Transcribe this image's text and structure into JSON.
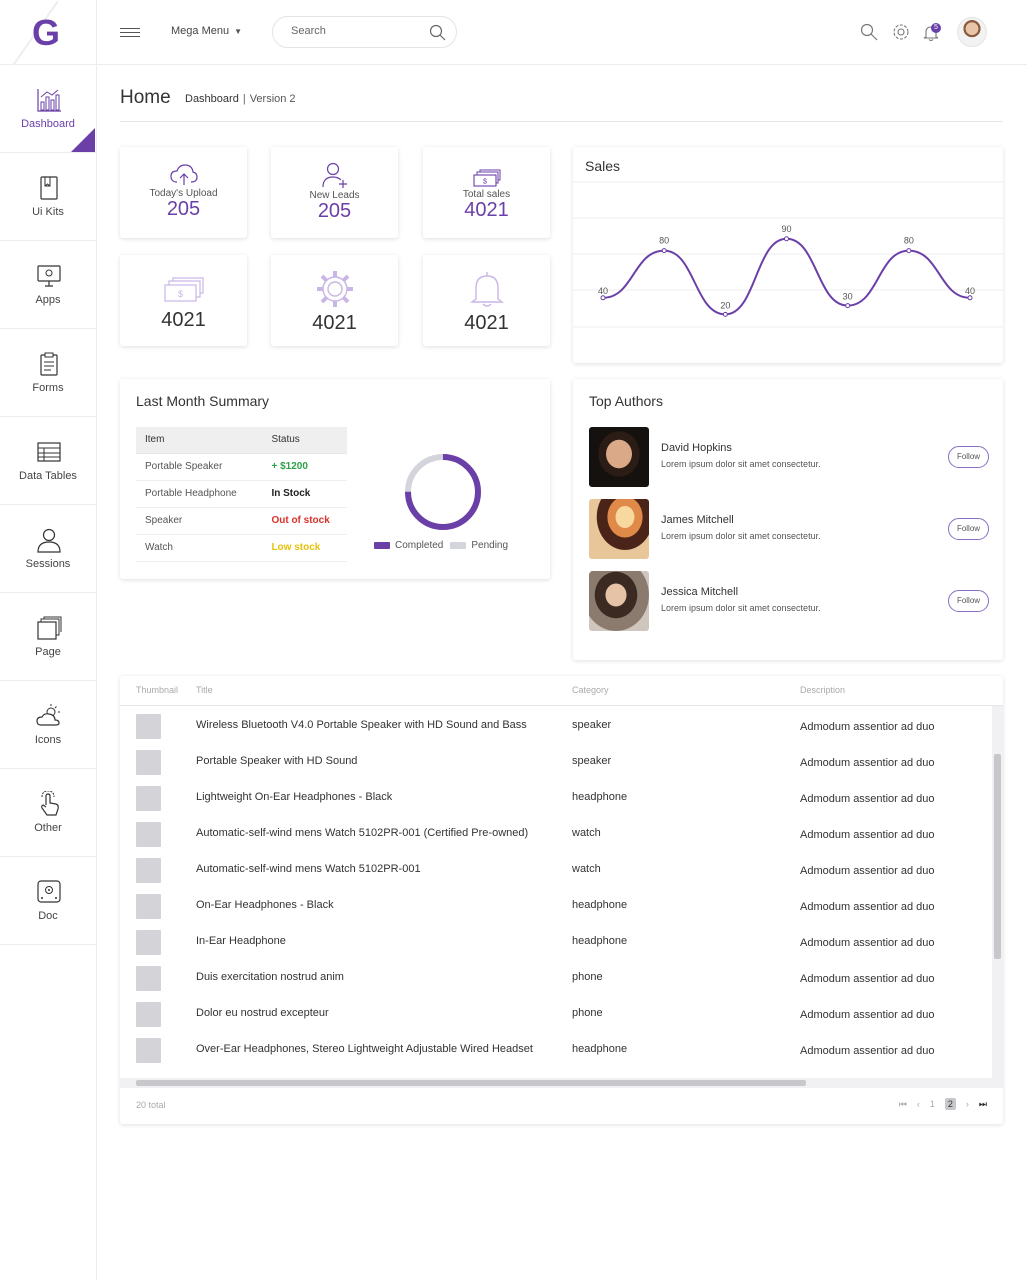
{
  "header": {
    "logo": "G",
    "mega_menu": "Mega Menu",
    "search_placeholder": "Search",
    "notification_count": "5",
    "accent": "#6a3fa8"
  },
  "sidebar": {
    "items": [
      {
        "label": "Dashboard",
        "icon": "bar-chart-icon",
        "active": true
      },
      {
        "label": "Ui Kits",
        "icon": "book-icon"
      },
      {
        "label": "Apps",
        "icon": "monitor-icon"
      },
      {
        "label": "Forms",
        "icon": "clipboard-icon"
      },
      {
        "label": "Data Tables",
        "icon": "table-icon"
      },
      {
        "label": "Sessions",
        "icon": "user-icon"
      },
      {
        "label": "Page",
        "icon": "pages-icon"
      },
      {
        "label": "Icons",
        "icon": "weather-icon"
      },
      {
        "label": "Other",
        "icon": "touch-icon"
      },
      {
        "label": "Doc",
        "icon": "safe-icon"
      }
    ]
  },
  "page": {
    "title": "Home",
    "breadcrumb_active": "Dashboard",
    "breadcrumb_version": "Version 2"
  },
  "stats": [
    {
      "label": "Today's Upload",
      "value": "205",
      "icon": "cloud-upload-icon"
    },
    {
      "label": "New Leads",
      "value": "205",
      "icon": "user-plus-icon"
    },
    {
      "label": "Total sales",
      "value": "4021",
      "icon": "money-icon"
    },
    {
      "label": "",
      "value": "4021",
      "icon": "money-stack-icon"
    },
    {
      "label": "",
      "value": "4021",
      "icon": "gear-icon"
    },
    {
      "label": "",
      "value": "4021",
      "icon": "bell-icon"
    }
  ],
  "sales": {
    "title": "Sales",
    "chart_data": {
      "type": "line",
      "title": "Sales",
      "values": [
        40,
        80,
        20,
        90,
        30,
        80,
        40
      ],
      "data_labels": [
        "40",
        "80",
        "20",
        "90",
        "30",
        "80",
        "40"
      ],
      "ylim": [
        0,
        100
      ],
      "grid": true,
      "color": "#6a3fa8"
    }
  },
  "summary": {
    "title": "Last Month Summary",
    "headers": [
      "Item",
      "Status"
    ],
    "rows": [
      {
        "item": "Portable Speaker",
        "status": "+ $1200",
        "kind": "green"
      },
      {
        "item": "Portable Headphone",
        "status": "In Stock",
        "kind": "dark"
      },
      {
        "item": "Speaker",
        "status": "Out of stock",
        "kind": "red"
      },
      {
        "item": "Watch",
        "status": "Low stock",
        "kind": "yellow"
      }
    ],
    "donut": {
      "completed_fraction": 0.75,
      "completed_label": "Completed",
      "pending_label": "Pending",
      "completed_color": "#6a3fa8",
      "pending_color": "#d4d4dc"
    }
  },
  "authors": {
    "title": "Top Authors",
    "follow_label": "Follow",
    "items": [
      {
        "name": "David Hopkins",
        "desc": "Lorem ipsum dolor sit amet consectetur."
      },
      {
        "name": "James Mitchell",
        "desc": "Lorem ipsum dolor sit amet consectetur."
      },
      {
        "name": "Jessica Mitchell",
        "desc": "Lorem ipsum dolor sit amet consectetur."
      }
    ]
  },
  "table": {
    "headers": [
      "Thumbnail",
      "Title",
      "Category",
      "Description"
    ],
    "rows": [
      {
        "title": "Wireless Bluetooth V4.0 Portable Speaker with HD Sound and Bass",
        "category": "speaker",
        "description": "Admodum assentior ad duo"
      },
      {
        "title": "Portable Speaker with HD Sound",
        "category": "speaker",
        "description": "Admodum assentior ad duo"
      },
      {
        "title": "Lightweight On-Ear Headphones - Black",
        "category": "headphone",
        "description": "Admodum assentior ad duo"
      },
      {
        "title": "Automatic-self-wind mens Watch 5102PR-001 (Certified Pre-owned)",
        "category": "watch",
        "description": "Admodum assentior ad duo"
      },
      {
        "title": "Automatic-self-wind mens Watch 5102PR-001",
        "category": "watch",
        "description": "Admodum assentior ad duo"
      },
      {
        "title": "On-Ear Headphones - Black",
        "category": "headphone",
        "description": "Admodum assentior ad duo"
      },
      {
        "title": "In-Ear Headphone",
        "category": "headphone",
        "description": "Admodum assentior ad duo"
      },
      {
        "title": "Duis exercitation nostrud anim",
        "category": "phone",
        "description": "Admodum assentior ad duo"
      },
      {
        "title": "Dolor eu nostrud excepteur",
        "category": "phone",
        "description": "Admodum assentior ad duo"
      },
      {
        "title": "Over-Ear Headphones, Stereo Lightweight Adjustable Wired Headset",
        "category": "headphone",
        "description": "Admodum assentior ad duo"
      }
    ],
    "total": "20 total",
    "pages": [
      "1",
      "2"
    ],
    "current_page": "2"
  }
}
